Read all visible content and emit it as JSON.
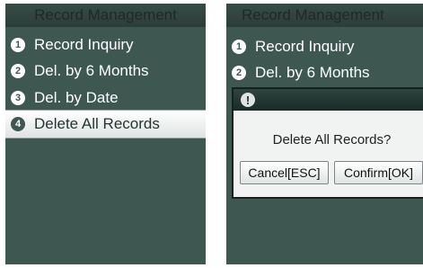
{
  "left": {
    "title": "Record Management",
    "items": [
      {
        "num": "1",
        "label": "Record Inquiry"
      },
      {
        "num": "2",
        "label": "Del. by 6 Months"
      },
      {
        "num": "3",
        "label": "Del. by Date"
      },
      {
        "num": "4",
        "label": "Delete All Records"
      }
    ]
  },
  "right": {
    "title": "Record Management",
    "items": [
      {
        "num": "1",
        "label": "Record Inquiry"
      },
      {
        "num": "2",
        "label": "Del. by 6 Months"
      }
    ],
    "dialog": {
      "icon": "!",
      "message": "Delete All Records?",
      "cancel_label": "Cancel[ESC]",
      "confirm_label": "Confirm[OK]"
    }
  },
  "colors": {
    "screen_bg": "#3e5750",
    "title_text": "#1d2a27",
    "selected_bg": "#ffffff"
  },
  "icons": {
    "number_badge": "numbered-circle-icon",
    "alert": "exclamation-icon"
  }
}
